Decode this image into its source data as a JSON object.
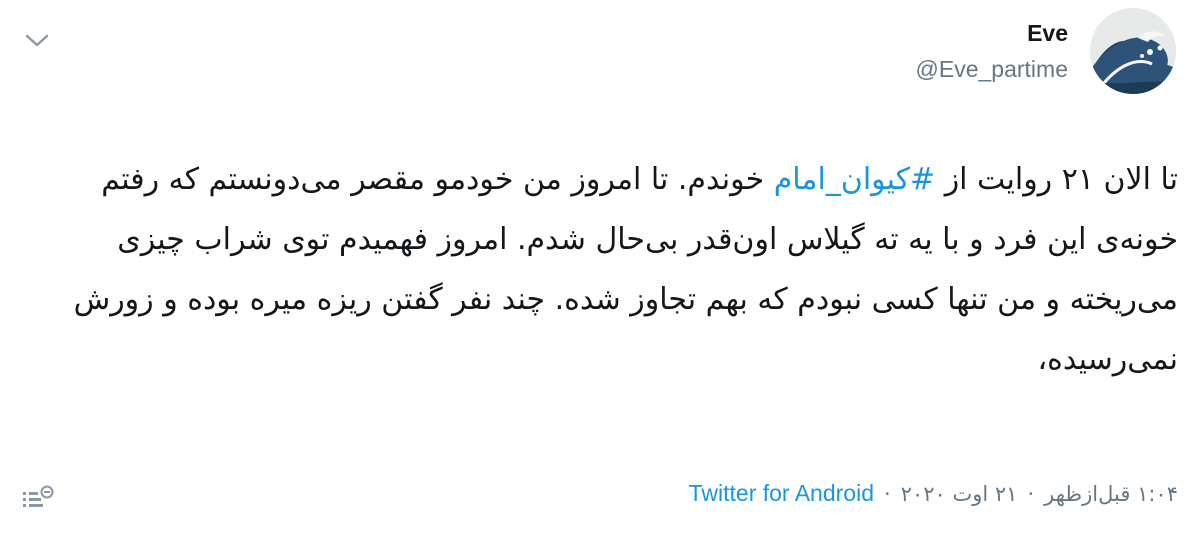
{
  "tweet": {
    "author": {
      "display_name": "Eve",
      "handle": "@Eve_partime"
    },
    "text_before": "تا الان ۲۱ روایت از ",
    "hashtag": "#کیوان_امام",
    "text_after": " خوندم. تا امروز من خودمو مقصر می‌دونستم که رفتم خونه‌ی این فرد و با یه ته گیلاس اون‌قدر بی‌حال شدم. امروز فهمیدم توی شراب چیزی می‌ریخته و من تنها کسی نبودم که بهم تجاوز شده. چند نفر گفتن ریزه میره بوده و زورش نمی‌رسیده،",
    "time": "۱:۰۴ قبل‌ازظهر",
    "date": "۲۱ اوت ۲۰۲۰",
    "source": "Twitter for Android",
    "separator": "·"
  },
  "colors": {
    "link": "#1b95e0",
    "secondary_text": "#657786",
    "primary_text": "#14171a"
  },
  "icons": {
    "menu": "chevron-down-icon",
    "analytics": "analytics-icon",
    "avatar": "wave-art-avatar"
  }
}
